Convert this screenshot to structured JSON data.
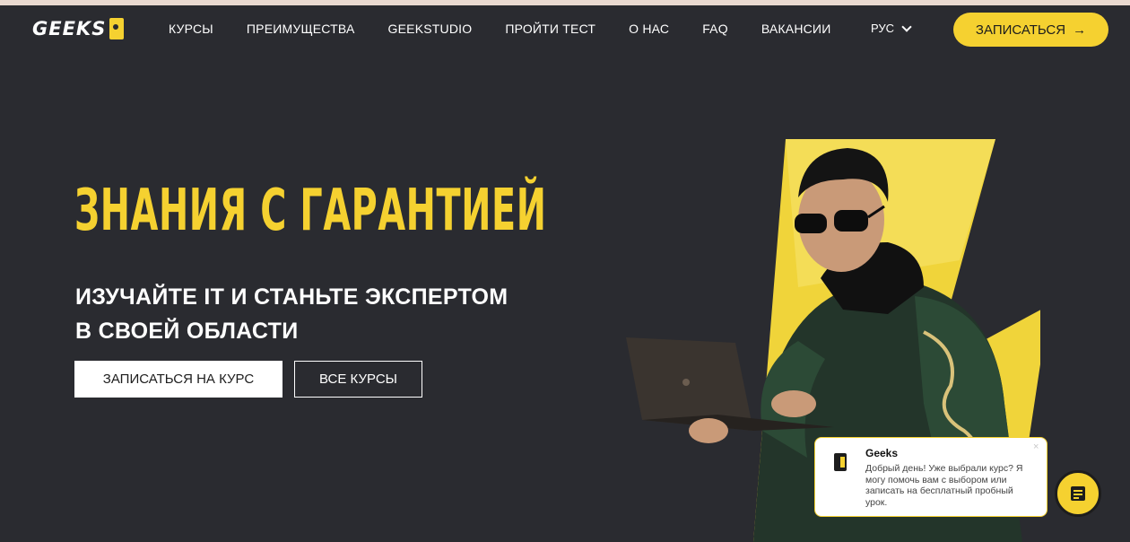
{
  "header": {
    "logo_text": "GEEKS",
    "nav": [
      "КУРСЫ",
      "ПРЕИМУЩЕСТВА",
      "GEEKSTUDIO",
      "ПРОЙТИ ТЕСТ",
      "О НАС",
      "FAQ",
      "ВАКАНСИИ"
    ],
    "lang": "РУС",
    "cta_label": "ЗАПИСАТЬСЯ",
    "cta_arrow": "→"
  },
  "hero": {
    "title": "ЗНАНИЯ С ГАРАНТИЕЙ",
    "subtitle_line1": "ИЗУЧАЙТЕ IT И СТАНЬТЕ ЭКСПЕРТОМ",
    "subtitle_line2": "В СВОЕЙ ОБЛАСТИ",
    "primary_button": "ЗАПИСАТЬСЯ НА КУРС",
    "secondary_button": "ВСЕ КУРСЫ"
  },
  "chat": {
    "name": "Geeks",
    "message": "Добрый день! Уже выбрали курс? Я могу помочь вам с выбором или записать на бесплатный пробный урок.",
    "close": "×"
  },
  "colors": {
    "accent": "#f5d130",
    "background": "#2a2b30"
  },
  "icons": {
    "logo_mark": "geeks-head-icon",
    "chevron": "chevron-down-icon",
    "chat_toggle": "chat-icon"
  }
}
